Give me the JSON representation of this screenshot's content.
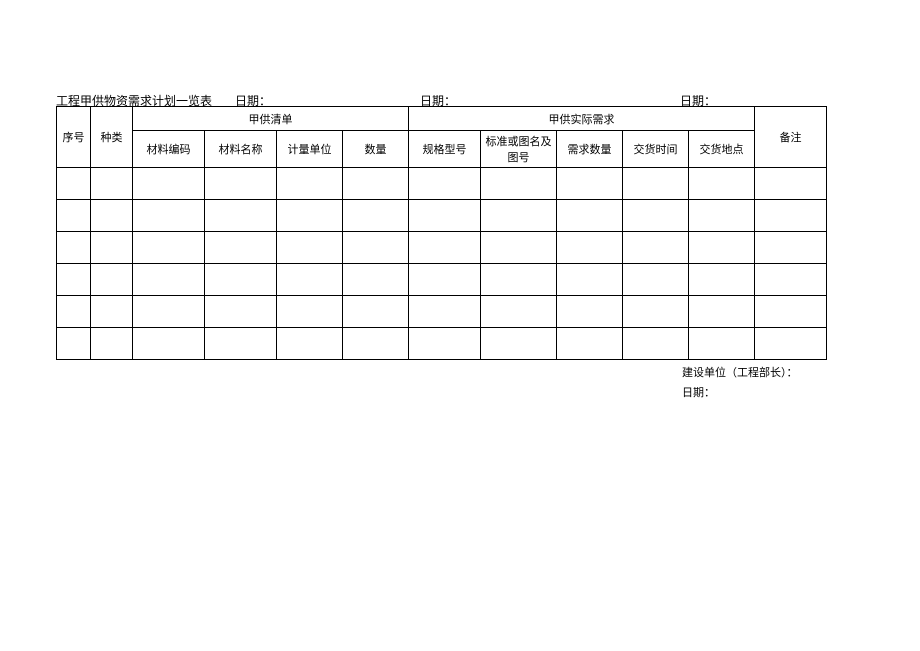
{
  "header": {
    "title_prefix": "日期",
    "title": "工程甲供物资需求计划一览表",
    "date_label_1": "日期：",
    "date_label_2": "日期：",
    "date_label_3": "日期："
  },
  "table": {
    "headers": {
      "seq": "序号",
      "type": "种类",
      "group_list": "甲供清单",
      "group_actual": "甲供实际需求",
      "remark": "备注",
      "material_code": "材料编码",
      "material_name": "材料名称",
      "unit": "计量单位",
      "qty": "数量",
      "spec": "规格型号",
      "standard": "标准或图名及图号",
      "req_qty": "需求数量",
      "delivery_time": "交货时间",
      "delivery_loc": "交货地点"
    },
    "rows": [
      {
        "seq": "",
        "type": "",
        "code": "",
        "name": "",
        "unit": "",
        "qty": "",
        "spec": "",
        "std": "",
        "reqqty": "",
        "dtime": "",
        "dloc": "",
        "remark": ""
      },
      {
        "seq": "",
        "type": "",
        "code": "",
        "name": "",
        "unit": "",
        "qty": "",
        "spec": "",
        "std": "",
        "reqqty": "",
        "dtime": "",
        "dloc": "",
        "remark": ""
      },
      {
        "seq": "",
        "type": "",
        "code": "",
        "name": "",
        "unit": "",
        "qty": "",
        "spec": "",
        "std": "",
        "reqqty": "",
        "dtime": "",
        "dloc": "",
        "remark": ""
      },
      {
        "seq": "",
        "type": "",
        "code": "",
        "name": "",
        "unit": "",
        "qty": "",
        "spec": "",
        "std": "",
        "reqqty": "",
        "dtime": "",
        "dloc": "",
        "remark": ""
      },
      {
        "seq": "",
        "type": "",
        "code": "",
        "name": "",
        "unit": "",
        "qty": "",
        "spec": "",
        "std": "",
        "reqqty": "",
        "dtime": "",
        "dloc": "",
        "remark": ""
      },
      {
        "seq": "",
        "type": "",
        "code": "",
        "name": "",
        "unit": "",
        "qty": "",
        "spec": "",
        "std": "",
        "reqqty": "",
        "dtime": "",
        "dloc": "",
        "remark": ""
      }
    ]
  },
  "footer": {
    "line1": "建设单位（工程部长）：",
    "line2": "日期："
  }
}
